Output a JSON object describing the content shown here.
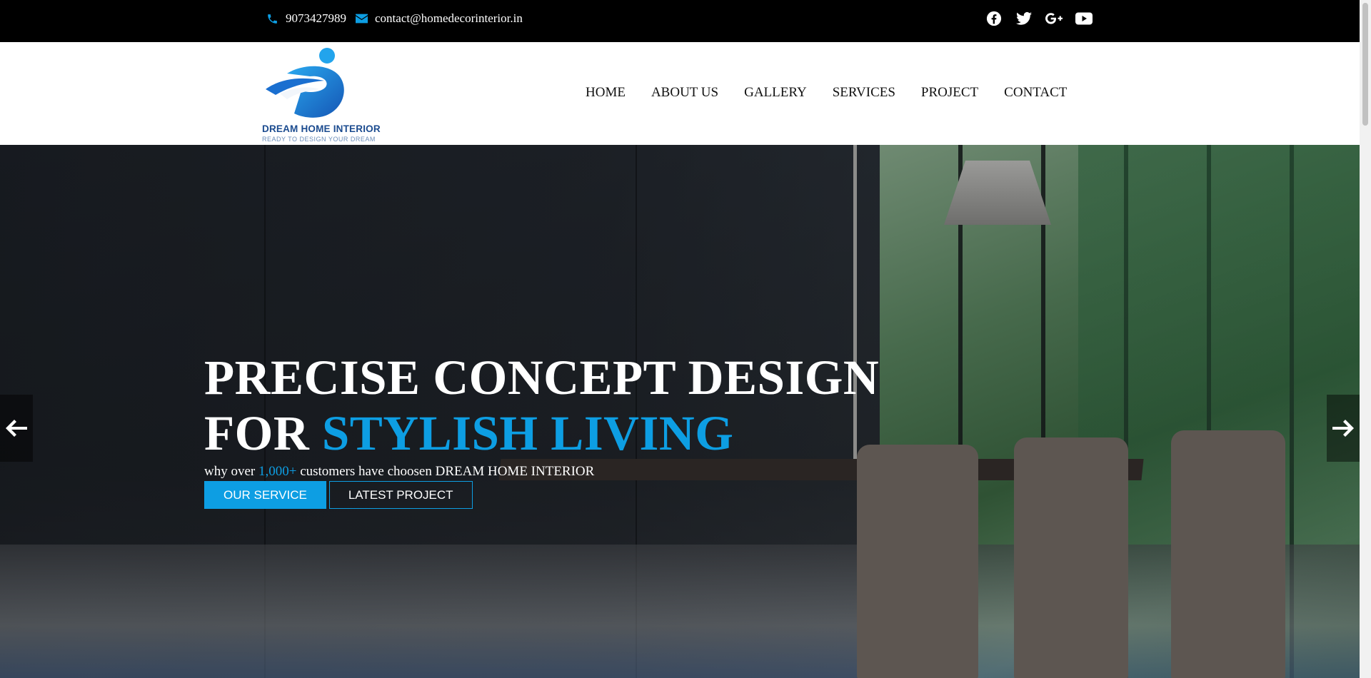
{
  "topbar": {
    "phone": "9073427989",
    "email": "contact@homedecorinterior.in",
    "social": [
      "facebook-icon",
      "twitter-icon",
      "google-plus-icon",
      "youtube-icon"
    ]
  },
  "logo": {
    "brand": "DREAM HOME INTERIOR",
    "tagline": "READY TO DESIGN YOUR DREAM"
  },
  "nav": {
    "items": [
      "HOME",
      "ABOUT US",
      "GALLERY",
      "SERVICES",
      "PROJECT",
      "CONTACT"
    ]
  },
  "hero": {
    "line1": "PRECISE CONCEPT DESIGN",
    "line2_plain": "FOR",
    "line2_accent": "STYLISH LIVING",
    "sub_before": "why over",
    "sub_number": "1,000+",
    "sub_after": "customers have choosen DREAM HOME INTERIOR",
    "btn_primary": "OUR SERVICE",
    "btn_outline": "LATEST PROJECT"
  },
  "colors": {
    "accent": "#0d9ee3",
    "topbar_bg": "#000000",
    "brand_blue": "#1b4b8f"
  }
}
